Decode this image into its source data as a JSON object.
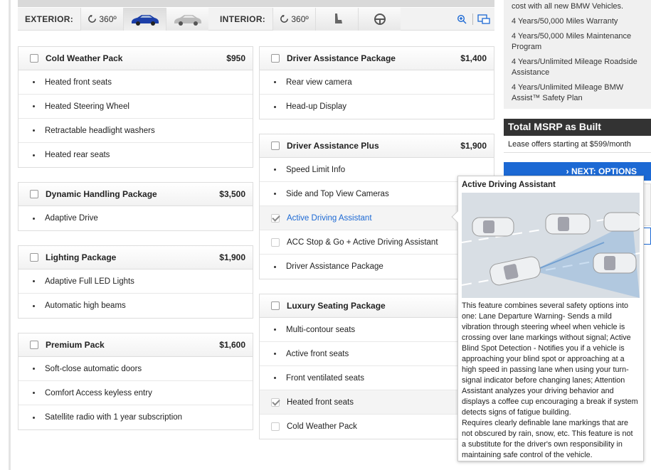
{
  "toolbar": {
    "exterior_label": "EXTERIOR:",
    "interior_label": "INTERIOR:",
    "rotate_label": "360º",
    "rotate_label_interior": "360º"
  },
  "packages_left": [
    {
      "title": "Cold Weather Pack",
      "price": "$950",
      "items": [
        "Heated front seats",
        "Heated Steering Wheel",
        "Retractable headlight washers",
        "Heated rear seats"
      ]
    },
    {
      "title": "Dynamic Handling Package",
      "price": "$3,500",
      "items": [
        "Adaptive Drive"
      ]
    },
    {
      "title": "Lighting Package",
      "price": "$1,900",
      "items": [
        "Adaptive Full LED Lights",
        "Automatic high beams"
      ]
    },
    {
      "title": "Premium Pack",
      "price": "$1,600",
      "items": [
        "Soft-close automatic doors",
        "Comfort Access keyless entry",
        "Satellite radio with 1 year subscription"
      ]
    }
  ],
  "packages_right": [
    {
      "title": "Driver Assistance Package",
      "price": "$1,400",
      "items": [
        "Rear view camera",
        "Head-up Display"
      ]
    },
    {
      "title": "Driver Assistance Plus",
      "price": "$1,900",
      "items": [
        "Speed Limit Info",
        "Side and Top View Cameras",
        "Active Driving Assistant",
        "ACC Stop & Go + Active Driving Assistant",
        "Driver Assistance Package"
      ]
    },
    {
      "title": "Luxury Seating Package",
      "price": "",
      "items": [
        "Multi-contour seats",
        "Active front seats",
        "Front ventilated seats",
        "Heated front seats",
        "Cold Weather Pack"
      ]
    }
  ],
  "benefits": [
    "cost with all new BMW Vehicles.",
    "4 Years/50,000 Miles Warranty",
    "4 Years/50,000 Miles Maintenance Program",
    "4 Years/Unlimited Mileage Roadside Assistance",
    "4 Years/Unlimited Mileage BMW Assist™ Safety Plan"
  ],
  "summary": {
    "total_label": "Total MSRP as Built",
    "lease_text": "Lease offers starting at $599/month",
    "next_button": "› NEXT: OPTIONS"
  },
  "tooltip": {
    "title": "Active Driving Assistant",
    "text": "This feature combines several safety options into one: Lane Departure Warning- Sends a mild vibration through steering wheel when vehicle is crossing over lane markings without signal; Active Blind Spot Detection - Notifies you if a vehicle is approaching your blind spot or approaching at a high speed in passing lane when using your turn-signal indicator before changing lanes; Attention Assistant analyzes your driving behavior and displays a coffee cup encouraging a break if system detects signs of fatigue building.",
    "text2": "Requires clearly definable lane markings that are not obscured by rain, snow, etc. This feature is not a substitute for the driver's own responsibility in maintaining safe control of the vehicle."
  },
  "colors": {
    "accent": "#1c69d4",
    "total_bg": "#333333"
  }
}
